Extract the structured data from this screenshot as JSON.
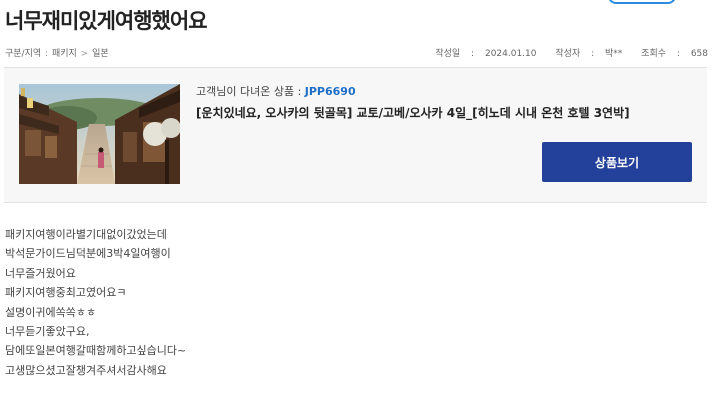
{
  "page": {
    "title": "너무재미있게여행했어요"
  },
  "breadcrumb": {
    "label": "구분/지역",
    "sep": ":",
    "items": [
      "패키지",
      "일본"
    ],
    "item_sep": ">"
  },
  "meta": {
    "date_label": "작성일",
    "date": "2024.01.10",
    "author_label": "작성자",
    "author": "박**",
    "views_label": "조회수",
    "views": "658",
    "sep": ":"
  },
  "product": {
    "intro_label": "고객님이 다녀온 상품 :",
    "code": "JPP6690",
    "title": "[운치있네요, 오사카의 뒷골목] 교토/고베/오사카 4일_[히노데 시내 온천 호텔 3연박]",
    "view_button": "상품보기",
    "thumbnail_desc": "kyoto-street-photo"
  },
  "review": {
    "lines": [
      "패키지여행이라별기대없이갔었는데",
      "박석문가이드님덕분에3박4일여행이",
      "너무즐거웠어요",
      "패키지여행중최고였어요ㅋ",
      "설명이귀에쏙쏙ㅎㅎ",
      "너무듣기좋았구요,",
      "담에또일본여행갈때함께하고싶습니다~",
      "고생많으셨고잘챙겨주셔서감사해요"
    ]
  },
  "colors": {
    "accent": "#23409a",
    "link": "#1f6fc9",
    "box_bg": "#f7f7f7"
  }
}
